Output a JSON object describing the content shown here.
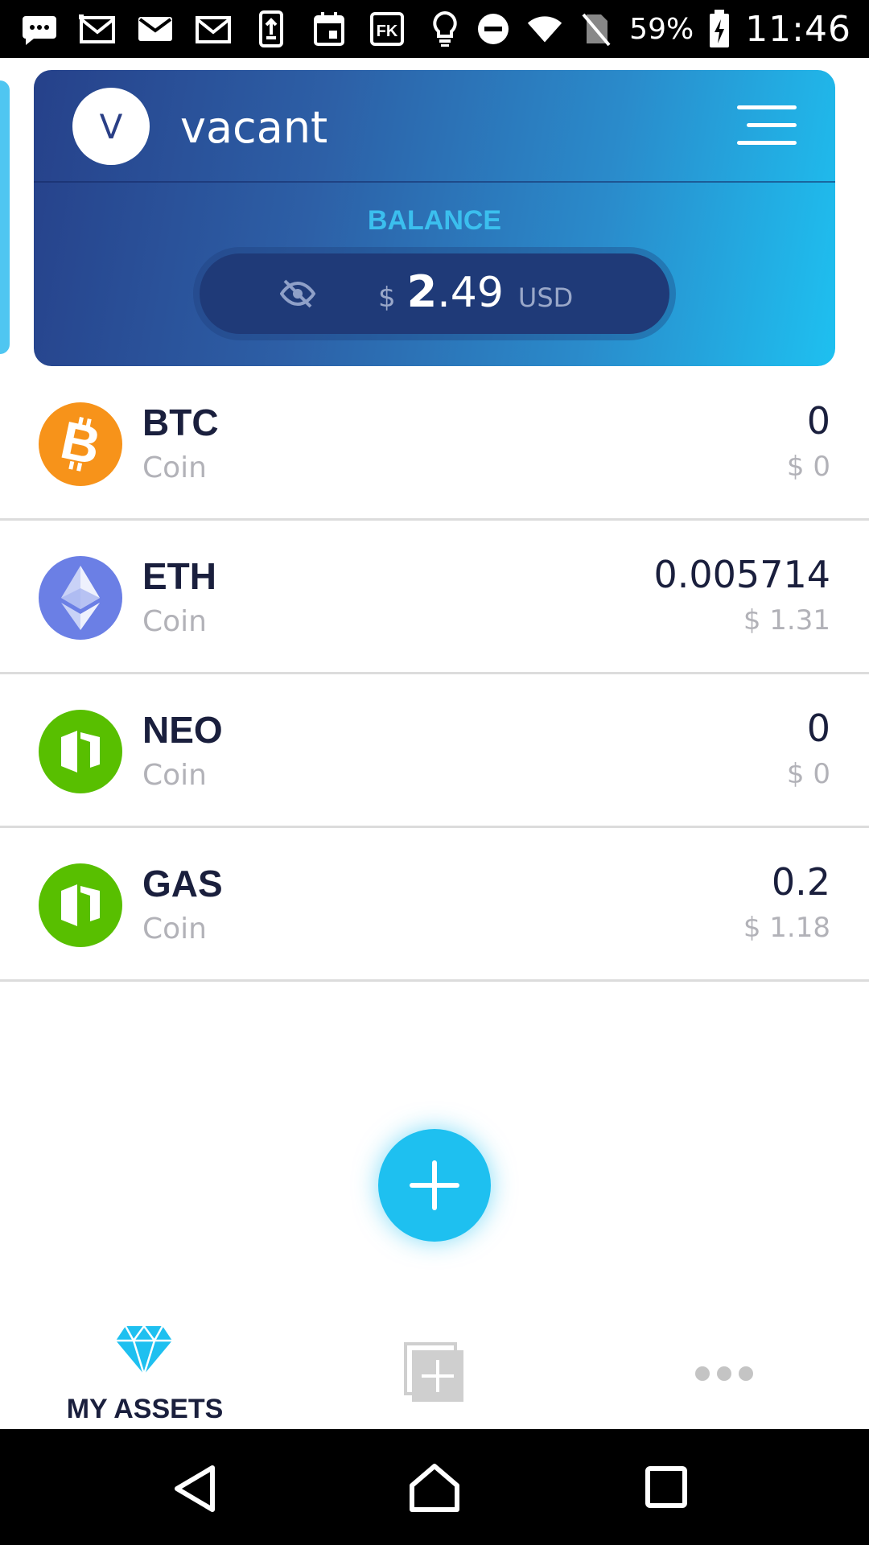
{
  "status_bar": {
    "icons": [
      "chat-icon",
      "gmail-icon",
      "mail-icon",
      "gmail-icon",
      "phone-update-icon",
      "calendar-icon",
      "fk-app-icon",
      "lightbulb-icon",
      "do-not-disturb-icon",
      "wifi-icon",
      "no-sim-icon",
      "battery-charging-icon"
    ],
    "battery": "59%",
    "time": "11:46"
  },
  "account": {
    "avatar_letter": "V",
    "name": "vacant"
  },
  "balance": {
    "label": "BALANCE",
    "currency_symbol": "$",
    "whole": "2",
    "fraction": ".49",
    "unit": "USD"
  },
  "assets": [
    {
      "symbol": "BTC",
      "kind": "Coin",
      "amount": "0",
      "fiat": "$ 0",
      "icon": "bitcoin-icon",
      "color": "#f7931a"
    },
    {
      "symbol": "ETH",
      "kind": "Coin",
      "amount": "0.005714",
      "fiat": "$ 1.31",
      "icon": "ethereum-icon",
      "color": "#6b7fe5"
    },
    {
      "symbol": "NEO",
      "kind": "Coin",
      "amount": "0",
      "fiat": "$ 0",
      "icon": "neo-icon",
      "color": "#58bf00"
    },
    {
      "symbol": "GAS",
      "kind": "Coin",
      "amount": "0.2",
      "fiat": "$ 1.18",
      "icon": "gas-icon",
      "color": "#58bf00"
    }
  ],
  "bottom_nav": {
    "assets_label": "MY ASSETS"
  },
  "colors": {
    "accent": "#1ec0f0",
    "header_start": "#26418a",
    "header_end": "#1ec0f0",
    "text_dark": "#1a1f3d"
  }
}
